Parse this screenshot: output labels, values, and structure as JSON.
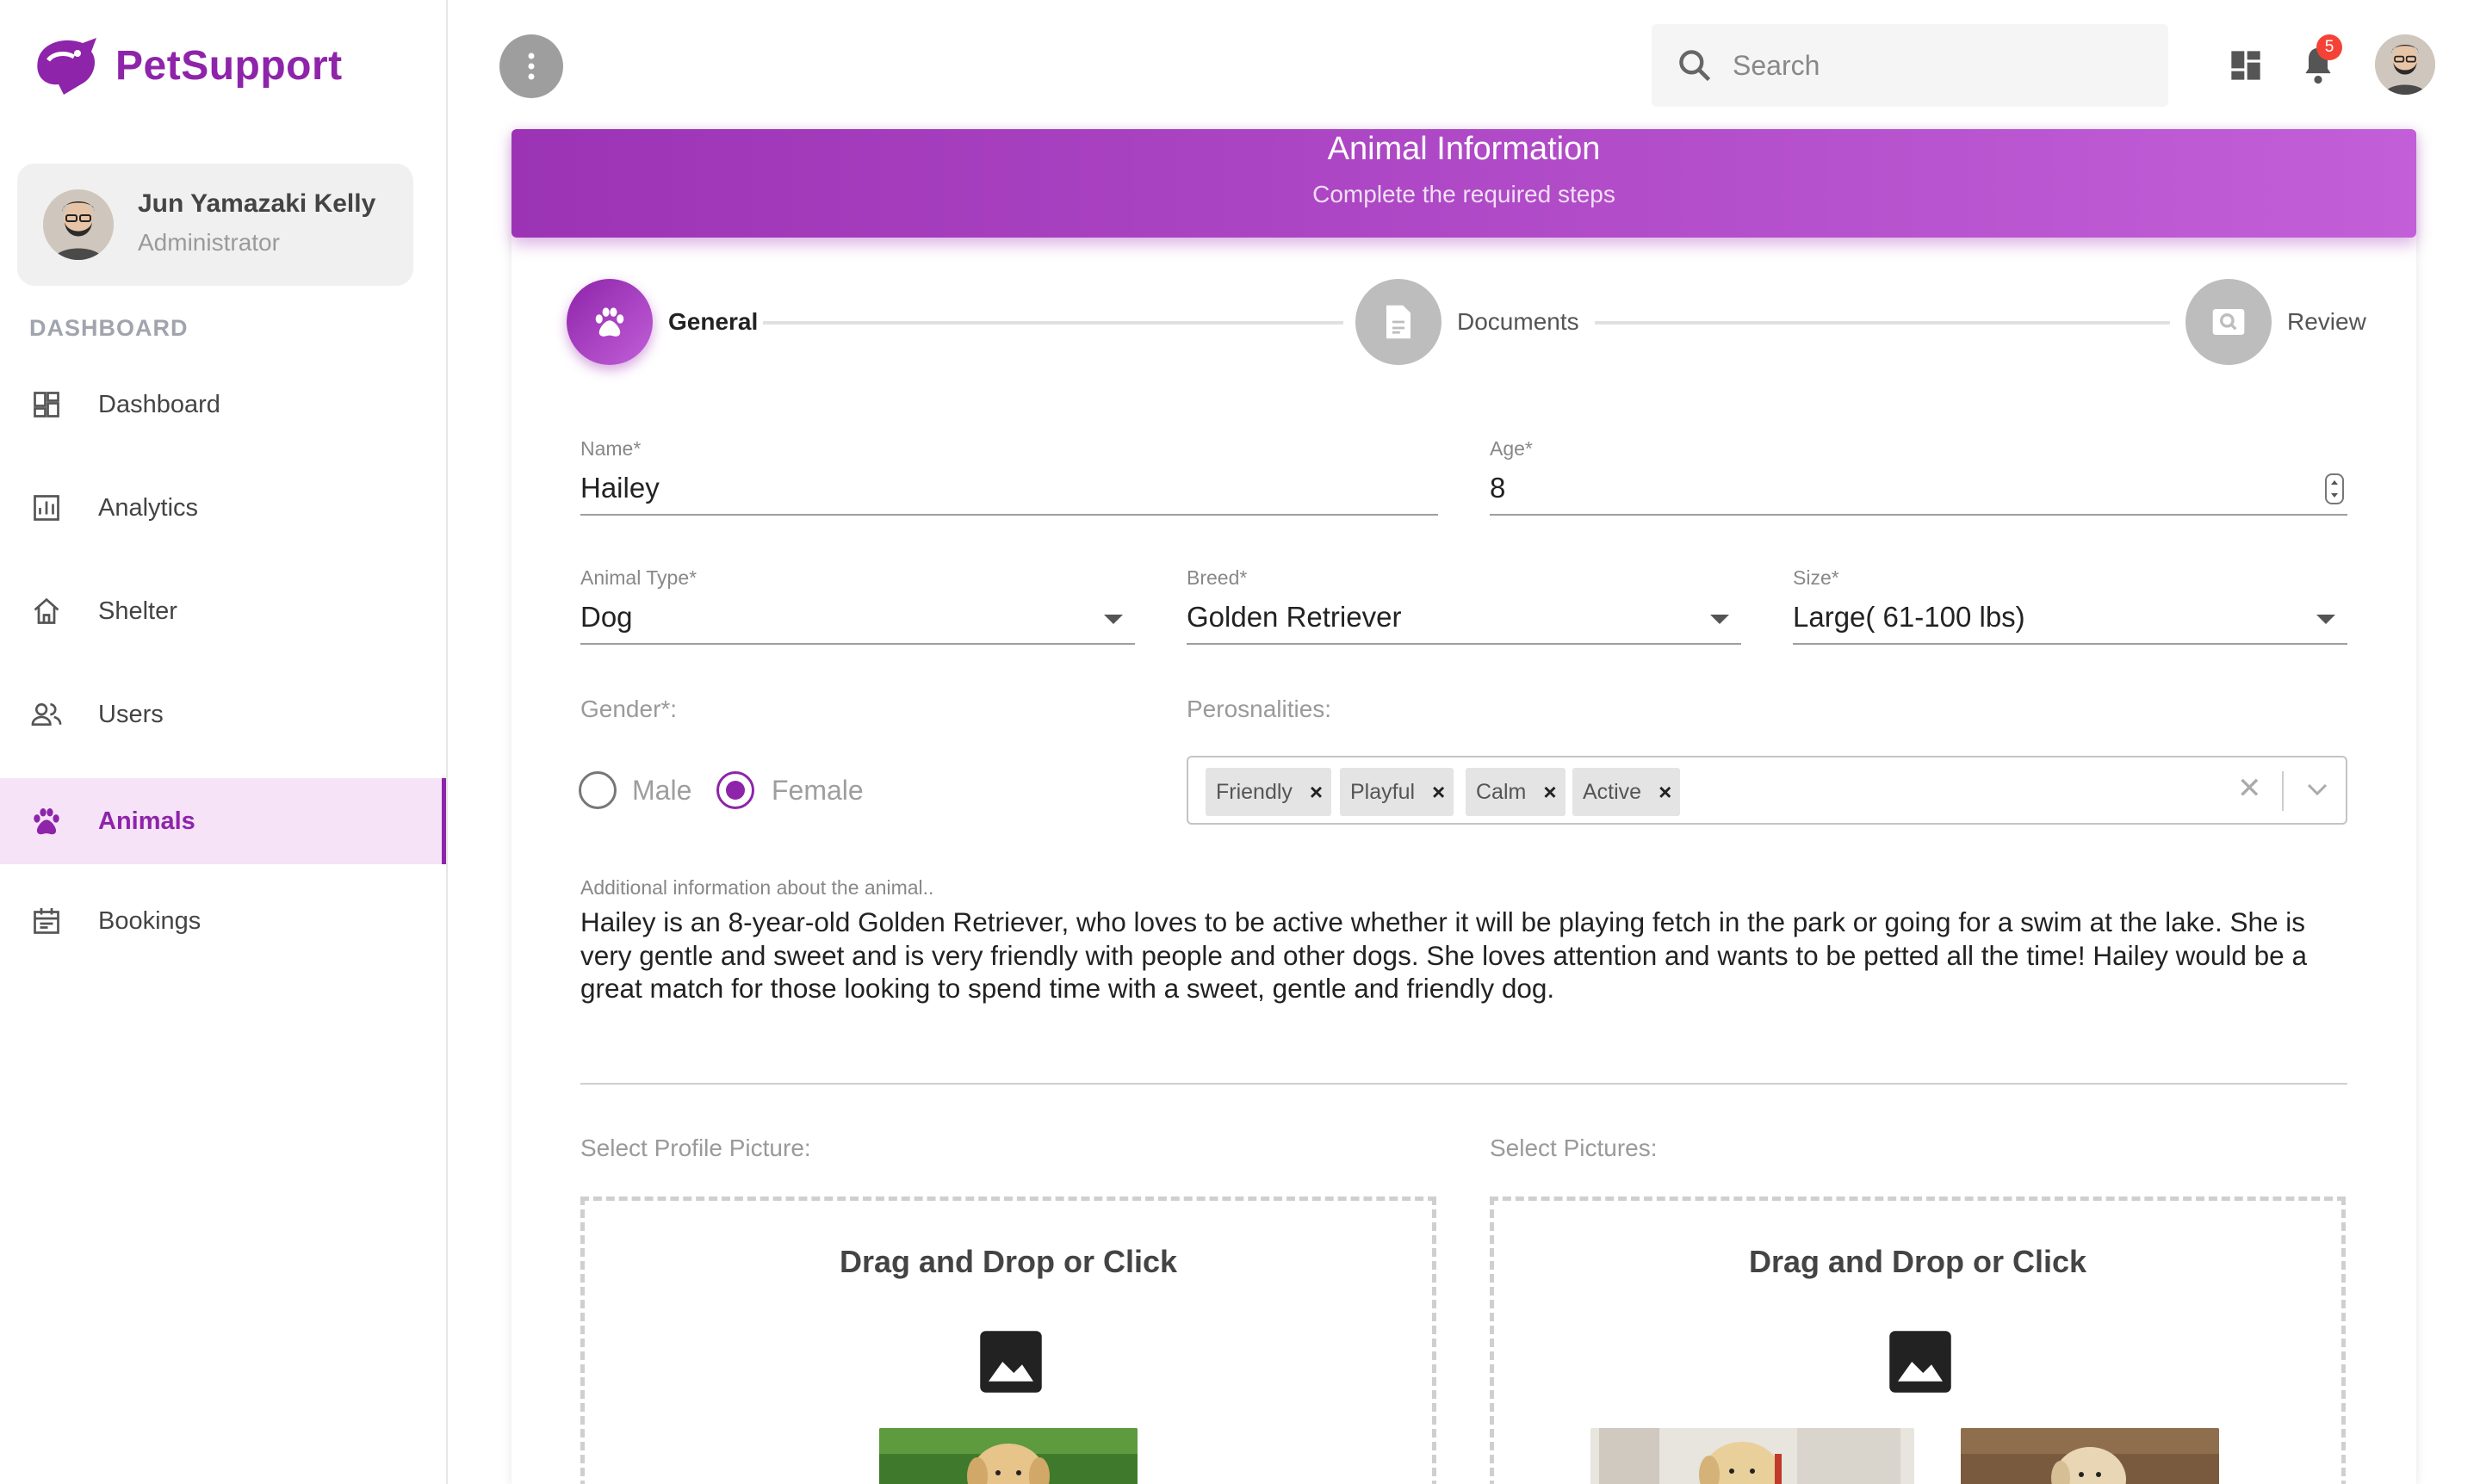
{
  "brand": {
    "name": "PetSupport"
  },
  "user": {
    "name": "Jun Yamazaki Kelly",
    "role": "Administrator"
  },
  "sidebar": {
    "section": "DASHBOARD",
    "items": [
      {
        "label": "Dashboard",
        "icon": "dashboard-icon"
      },
      {
        "label": "Analytics",
        "icon": "analytics-icon"
      },
      {
        "label": "Shelter",
        "icon": "home-icon"
      },
      {
        "label": "Users",
        "icon": "users-icon"
      },
      {
        "label": "Animals",
        "icon": "paw-icon",
        "active": true
      },
      {
        "label": "Bookings",
        "icon": "calendar-icon"
      }
    ]
  },
  "topbar": {
    "search_placeholder": "Search",
    "notification_count": "5"
  },
  "card": {
    "title": "Animal Information",
    "subtitle": "Complete the required steps"
  },
  "stepper": {
    "steps": [
      {
        "label": "General",
        "icon": "paw-icon",
        "active": true
      },
      {
        "label": "Documents",
        "icon": "document-icon",
        "active": false
      },
      {
        "label": "Review",
        "icon": "review-icon",
        "active": false
      }
    ]
  },
  "form": {
    "name": {
      "label": "Name*",
      "value": "Hailey"
    },
    "age": {
      "label": "Age*",
      "value": "8"
    },
    "animal_type": {
      "label": "Animal Type*",
      "value": "Dog"
    },
    "breed": {
      "label": "Breed*",
      "value": "Golden Retriever"
    },
    "size": {
      "label": "Size*",
      "value": "Large( 61-100 lbs)"
    },
    "gender": {
      "label": "Gender*:",
      "options": [
        "Male",
        "Female"
      ],
      "selected": "Female"
    },
    "personalities": {
      "label": "Perosnalities:",
      "chips": [
        "Friendly",
        "Playful",
        "Calm",
        "Active"
      ]
    },
    "description": {
      "label": "Additional information about the animal..",
      "value": "Hailey is an 8-year-old Golden Retriever, who loves to be active whether it will be playing fetch in the park or going for a swim at the lake. She is very gentle and sweet and is very friendly with people and other dogs. She loves attention and wants to be petted all the time! Hailey would be a great match for those looking to spend time with a sweet, gentle and friendly dog."
    },
    "profile_picture": {
      "label": "Select Profile Picture:",
      "drop_text": "Drag and Drop or Click"
    },
    "pictures": {
      "label": "Select Pictures:",
      "drop_text": "Drag and Drop or Click"
    }
  },
  "colors": {
    "accent": "#8e24aa",
    "badge": "#f44336"
  }
}
